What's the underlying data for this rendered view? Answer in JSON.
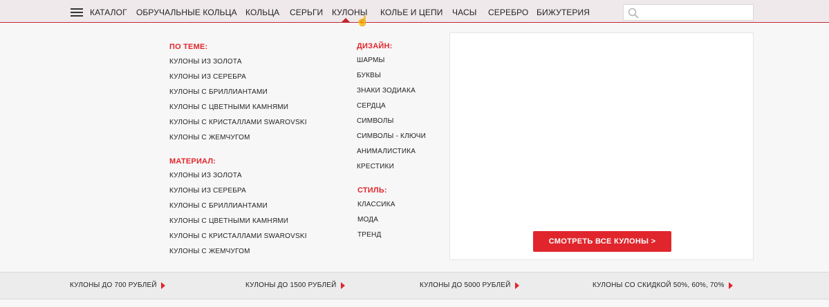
{
  "nav": {
    "catalog": "КАТАЛОГ",
    "items": [
      "ОБРУЧАЛЬНЫЕ КОЛЬЦА",
      "КОЛЬЦА",
      "СЕРЬГИ",
      "КУЛОНЫ",
      "КОЛЬЕ И ЦЕПИ",
      "ЧАСЫ",
      "СЕРЕБРО",
      "БИЖУТЕРИЯ"
    ],
    "active": "КУЛОНЫ",
    "search_placeholder": "",
    "accent_color": "#c0272d"
  },
  "menu": {
    "theme": {
      "title": "ПО ТЕМЕ:",
      "links": [
        "КУЛОНЫ ИЗ ЗОЛОТА",
        "КУЛОНЫ ИЗ СЕРЕБРА",
        "КУЛОНЫ С БРИЛЛИАНТАМИ",
        "КУЛОНЫ С ЦВЕТНЫМИ КАМНЯМИ",
        "КУЛОНЫ С КРИСТАЛЛАМИ SWAROVSKI",
        "КУЛОНЫ С ЖЕМЧУГОМ"
      ]
    },
    "material": {
      "title": "МАТЕРИАЛ:",
      "links": [
        "КУЛОНЫ ИЗ ЗОЛОТА",
        "КУЛОНЫ ИЗ СЕРЕБРА",
        "КУЛОНЫ С БРИЛЛИАНТАМИ",
        "КУЛОНЫ С ЦВЕТНЫМИ КАМНЯМИ",
        "КУЛОНЫ С КРИСТАЛЛАМИ SWAROVSKI",
        "КУЛОНЫ С ЖЕМЧУГОМ"
      ]
    },
    "design": {
      "title": "ДИЗАЙН:",
      "links": [
        "ШАРМЫ",
        "БУКВЫ",
        "ЗНАКИ ЗОДИАКА",
        "СЕРДЦА",
        "СИМВОЛЫ",
        "СИМВОЛЫ - КЛЮЧИ",
        "АНИМАЛИСТИКА",
        "КРЕСТИКИ"
      ]
    },
    "style": {
      "title": "СТИЛЬ:",
      "links": [
        "КЛАССИКА",
        "МОДА",
        "ТРЕНД"
      ]
    },
    "view_all": "СМОТРЕТЬ ВСЕ КУЛОНЫ >",
    "title_color": "#e0262c"
  },
  "bottom": {
    "links": [
      "КУЛОНЫ ДО 700 РУБЛЕЙ",
      "КУЛОНЫ ДО 1500 РУБЛЕЙ",
      "КУЛОНЫ ДО 5000 РУБЛЕЙ",
      "КУЛОНЫ СО СКИДКОЙ 50%, 60%, 70%"
    ]
  }
}
